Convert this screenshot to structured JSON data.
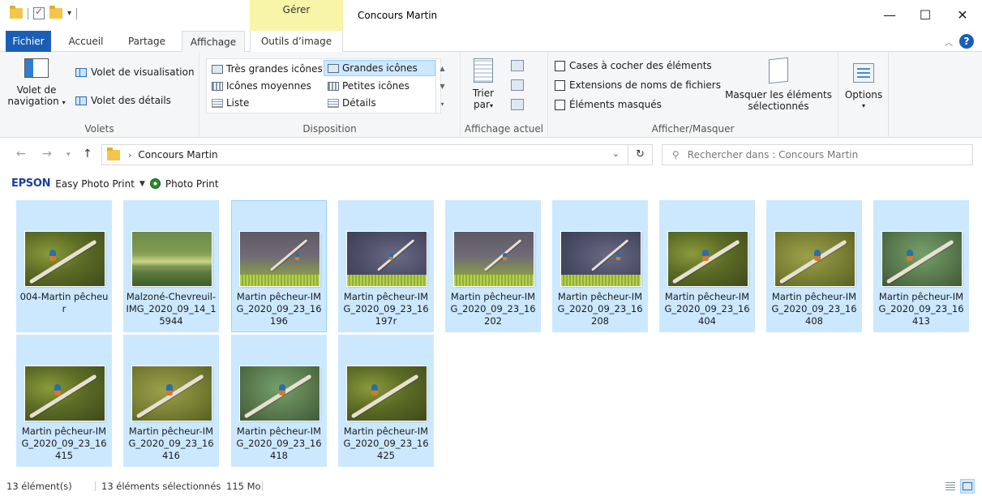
{
  "window": {
    "title": "Concours Martin",
    "contextual_tab": "Gérer",
    "minimize_label": "—",
    "maximize_label": "☐",
    "close_label": "✕"
  },
  "qat": {
    "dropdown": "▾"
  },
  "tabs": {
    "file": "Fichier",
    "home": "Accueil",
    "share": "Partage",
    "view": "Affichage",
    "image_tools": "Outils d’image"
  },
  "ribbon": {
    "volets": {
      "label": "Volets",
      "nav_pane": "Volet de navigation",
      "nav_pane_line1": "Volet de",
      "nav_pane_line2": "navigation",
      "preview_pane": "Volet de visualisation",
      "details_pane": "Volet des détails"
    },
    "disposition": {
      "label": "Disposition",
      "items": [
        "Très grandes icônes",
        "Grandes icônes",
        "Icônes moyennes",
        "Petites icônes",
        "Liste",
        "Détails"
      ],
      "selected": "Grandes icônes"
    },
    "current_view": {
      "label": "Affichage actuel",
      "sort_line1": "Trier",
      "sort_line2": "par"
    },
    "show_hide": {
      "label": "Afficher/Masquer",
      "item_checkboxes": "Cases à cocher des éléments",
      "file_extensions": "Extensions de noms de fichiers",
      "hidden_items": "Éléments masqués",
      "hide_selected_line1": "Masquer les éléments",
      "hide_selected_line2": "sélectionnés"
    },
    "options": {
      "label": "Options"
    }
  },
  "address": {
    "path": "Concours Martin",
    "search_placeholder": "Rechercher dans : Concours Martin"
  },
  "epson": {
    "brand": "EPSON",
    "easy_photo_print": "Easy Photo Print",
    "photo_print": "Photo Print"
  },
  "files": [
    {
      "name": "004-Martin pêcheur",
      "thumb": "kingfisher-branch"
    },
    {
      "name": "Malzoné-Chevreuil-IMG_2020_09_14_15944",
      "thumb": "pond-landscape"
    },
    {
      "name": "Martin pêcheur-IMG_2020_09_23_16196",
      "thumb": "kingfisher-far"
    },
    {
      "name": "Martin pêcheur-IMG_2020_09_23_16197r",
      "thumb": "kingfisher-far"
    },
    {
      "name": "Martin pêcheur-IMG_2020_09_23_16202",
      "thumb": "kingfisher-far"
    },
    {
      "name": "Martin pêcheur-IMG_2020_09_23_16208",
      "thumb": "kingfisher-far"
    },
    {
      "name": "Martin pêcheur-IMG_2020_09_23_16404",
      "thumb": "kingfisher-branch"
    },
    {
      "name": "Martin pêcheur-IMG_2020_09_23_16408",
      "thumb": "kingfisher-branch"
    },
    {
      "name": "Martin pêcheur-IMG_2020_09_23_16413",
      "thumb": "kingfisher-branch"
    },
    {
      "name": "Martin pêcheur-IMG_2020_09_23_16415",
      "thumb": "kingfisher-branch"
    },
    {
      "name": "Martin pêcheur-IMG_2020_09_23_16416",
      "thumb": "kingfisher-branch"
    },
    {
      "name": "Martin pêcheur-IMG_2020_09_23_16418",
      "thumb": "kingfisher-branch"
    },
    {
      "name": "Martin pêcheur-IMG_2020_09_23_16425",
      "thumb": "kingfisher-branch"
    }
  ],
  "status": {
    "item_count": "13 élément(s)",
    "selected_count": "13 éléments sélectionnés",
    "selected_size": "115 Mo"
  },
  "colors": {
    "accent": "#1a5fb4",
    "selection": "#cce8ff",
    "selection_border": "#99d1ff",
    "manage_tab": "#f8f5a9"
  }
}
